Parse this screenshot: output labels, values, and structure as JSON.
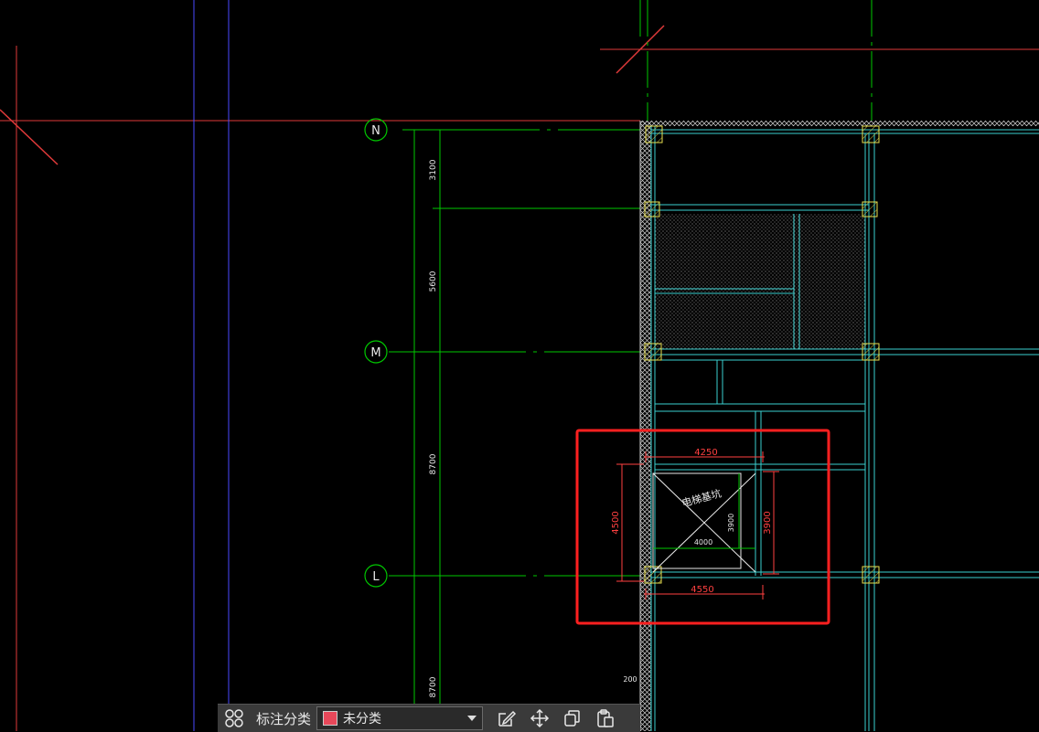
{
  "axes": [
    {
      "id": "N",
      "label": "N"
    },
    {
      "id": "M",
      "label": "M"
    },
    {
      "id": "L",
      "label": "L"
    }
  ],
  "dims_vertical": [
    "3100",
    "5600",
    "8700",
    "8700"
  ],
  "elevator": {
    "title": "电梯基坑",
    "dim_top": "4250",
    "dim_bottom": "4550",
    "dim_left": "4500",
    "dim_right": "3900",
    "dim_inner_right": "3900",
    "dim_inner_bottom": "4000"
  },
  "small_dim": "200",
  "toolbar": {
    "grid_icon": "grid-icon",
    "label": "标注分类",
    "category": "未分类",
    "category_color": "#e8485a",
    "edit_icon": "edit-icon",
    "move_icon": "move-icon",
    "copy_icon": "copy-icon",
    "paste_icon": "paste-icon"
  },
  "colors": {
    "grid_red": "#e03a3a",
    "axis_green": "#00c800",
    "wall_cyan": "#3ad0d0",
    "annot_red": "#ff4040",
    "highlight": "#ff2020",
    "column_yellow": "#e8e050"
  }
}
